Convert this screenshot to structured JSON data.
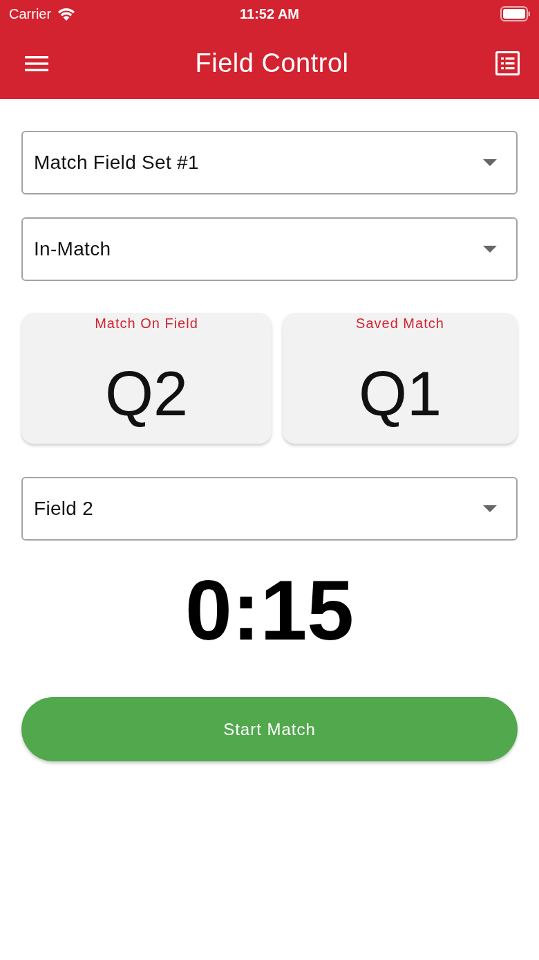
{
  "status_bar": {
    "carrier": "Carrier",
    "time": "11:52 AM"
  },
  "app_bar": {
    "title": "Field Control"
  },
  "selects": [
    {
      "value": "Match Field Set #1"
    },
    {
      "value": "In-Match"
    }
  ],
  "match_cards": [
    {
      "label": "Match On Field",
      "value": "Q2"
    },
    {
      "label": "Saved Match",
      "value": "Q1"
    }
  ],
  "field_select": {
    "value": "Field 2"
  },
  "timer": "0:15",
  "start_button": {
    "label": "Start Match"
  }
}
